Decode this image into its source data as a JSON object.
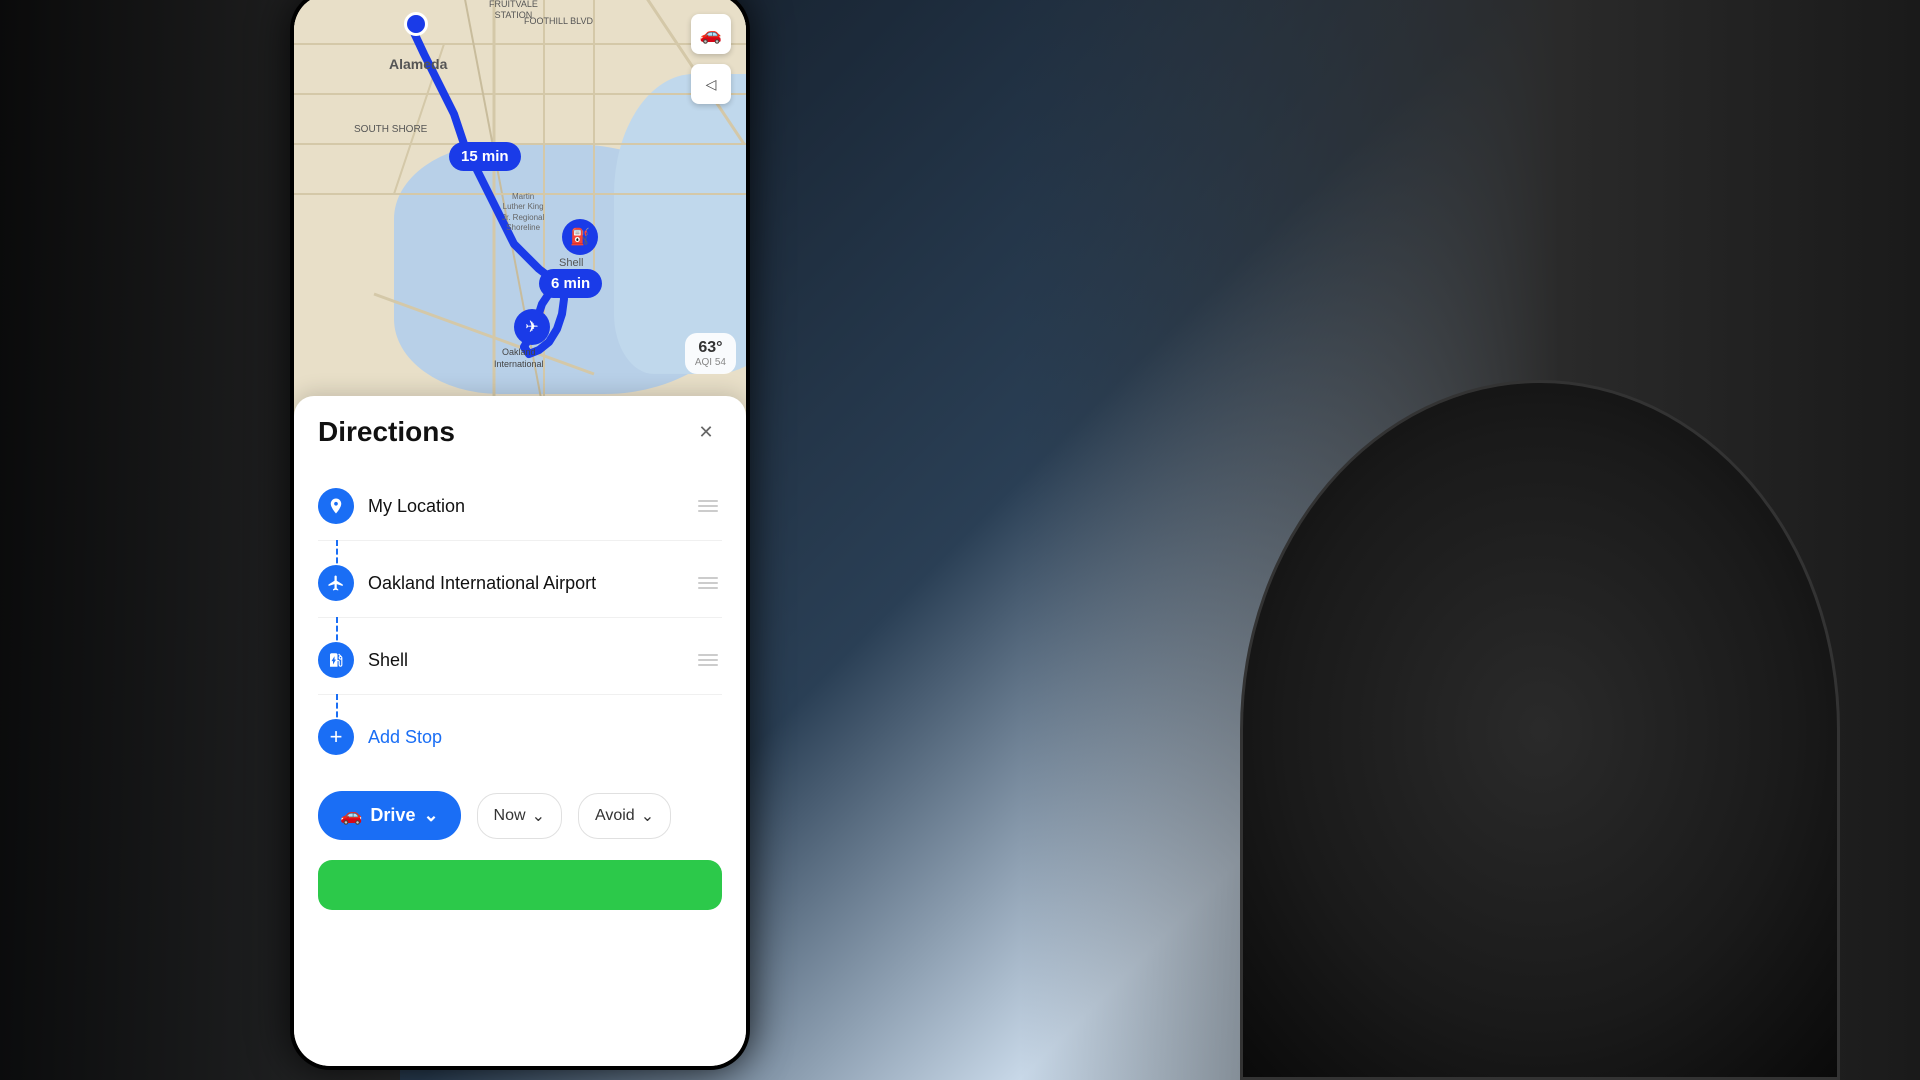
{
  "scene": {
    "bg_description": "Car interior with hand holding phone"
  },
  "map": {
    "time_bubbles": [
      {
        "id": "15min",
        "label": "15 min"
      },
      {
        "id": "6min",
        "label": "6 min"
      }
    ],
    "weather": {
      "temp": "63°",
      "aqi_label": "AQI",
      "aqi_value": "54"
    },
    "labels": {
      "alameda": "Alameda",
      "fruitvale": "FRUITVALE\nSTATION",
      "foothill": "FOOTHILL BLVD",
      "southshore": "SOUTH SHORE",
      "mlk": "Martin\nLuther King\nJr. Regional\nShoreline",
      "shell": "Shell",
      "oakland_intl": "Oakland\nInternational"
    },
    "buttons": {
      "car_icon": "🚗",
      "compass_icon": "◁"
    }
  },
  "directions": {
    "title": "Directions",
    "close_button": "✕",
    "stops": [
      {
        "id": "my-location",
        "icon": "location",
        "icon_char": "◎",
        "label": "My Location",
        "draggable": true
      },
      {
        "id": "oakland-airport",
        "icon": "airport",
        "icon_char": "✈",
        "label": "Oakland International Airport",
        "draggable": true
      },
      {
        "id": "shell",
        "icon": "gas",
        "icon_char": "⛽",
        "label": "Shell",
        "draggable": true
      },
      {
        "id": "add-stop",
        "icon": "add",
        "icon_char": "+",
        "label": "Add Stop",
        "draggable": false,
        "is_action": true
      }
    ],
    "controls": {
      "drive_label": "Drive",
      "drive_icon": "🚗",
      "now_label": "Now",
      "avoid_label": "Avoid",
      "chevron": "⌄"
    },
    "go_button": {
      "visible": true
    }
  }
}
